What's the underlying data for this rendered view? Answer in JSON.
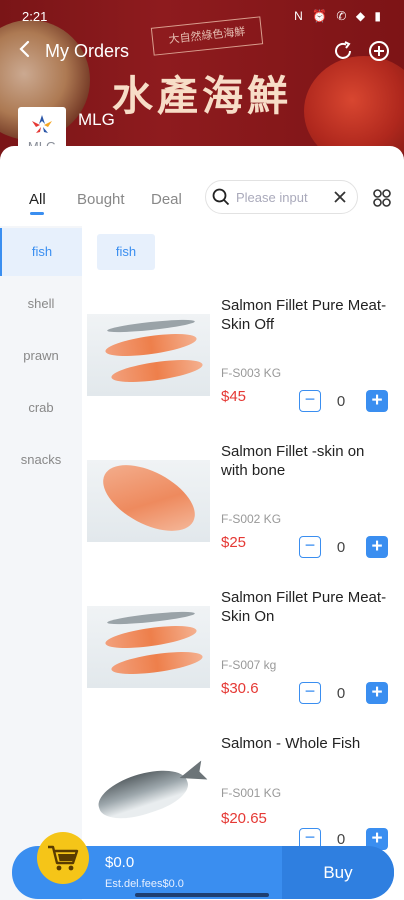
{
  "status_bar": {
    "time": "2:21",
    "indicators": "N ⏰ ✆ ◆ ▮"
  },
  "nav": {
    "title": "My Orders"
  },
  "banner": {
    "calligraphy": "大自然綠色海鮮",
    "headline": "水產海鮮"
  },
  "brand": {
    "logo_text": "MLG",
    "name": "MLG"
  },
  "tabs": [
    {
      "label": "All",
      "active": true
    },
    {
      "label": "Bought",
      "active": false
    },
    {
      "label": "Deal",
      "active": false
    }
  ],
  "search": {
    "placeholder": "Please input"
  },
  "categories": [
    {
      "label": "fish",
      "active": true
    },
    {
      "label": "shell",
      "active": false
    },
    {
      "label": "prawn",
      "active": false
    },
    {
      "label": "crab",
      "active": false
    },
    {
      "label": "snacks",
      "active": false
    }
  ],
  "selected_chip": "fish",
  "products": [
    {
      "name": "Salmon  Fillet Pure Meat- Skin Off",
      "code": "F-S003 KG",
      "price": "$45",
      "qty": "0",
      "image": "salmon-fillet-skinless-image"
    },
    {
      "name": "Salmon Fillet -skin on with bone",
      "code": "F-S002 KG",
      "price": "$25",
      "qty": "0",
      "image": "salmon-fillet-bone-image"
    },
    {
      "name": "Salmon  Fillet Pure Meat- Skin On",
      "code": "F-S007 kg",
      "price": "$30.6",
      "qty": "0",
      "image": "salmon-fillet-skin-on-image"
    },
    {
      "name": "Salmon - Whole Fish",
      "code": "F-S001 KG",
      "price": "$20.65",
      "qty": "0",
      "image": "whole-salmon-image"
    }
  ],
  "cart": {
    "total": "$0.0",
    "delivery_fee": "Est.del.fees$0.0",
    "buy_label": "Buy"
  },
  "colors": {
    "accent": "#3a8ef0",
    "price": "#e53935",
    "banner": "#8e1b1e",
    "cart_badge": "#f5c518"
  }
}
